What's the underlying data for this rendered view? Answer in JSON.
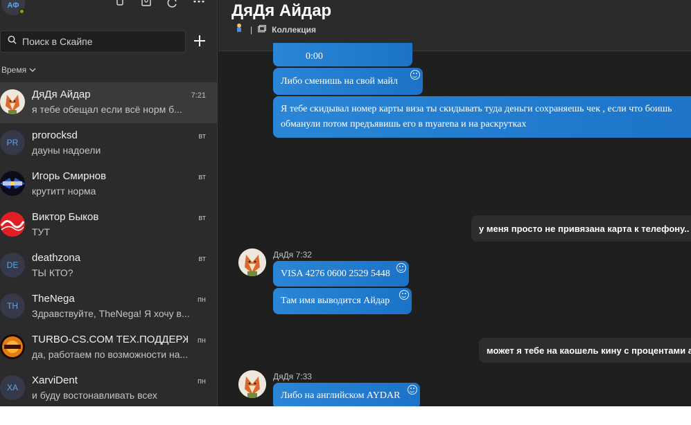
{
  "profile": {
    "initials": "АФ"
  },
  "search": {
    "placeholder": "Поиск в Скайпе"
  },
  "sort": {
    "label": "Время"
  },
  "chats": [
    {
      "name": "ДяДя Айдар",
      "preview": "я тебе обещал если всё норм б...",
      "time": "7:21",
      "avatar": "fox"
    },
    {
      "name": "prorocksd",
      "preview": "дауны надоели",
      "time": "вт",
      "initials": "PR"
    },
    {
      "name": "Игорь Смирнов",
      "preview": "крутитт норма",
      "time": "вт",
      "avatar": "game"
    },
    {
      "name": "Виктор Быков",
      "preview": "ТУТ",
      "time": "вт",
      "avatar": "cocacola"
    },
    {
      "name": "deathzona",
      "preview": "ТЫ КТО?",
      "time": "вт",
      "initials": "DE"
    },
    {
      "name": "TheNega",
      "preview": "Здравствуйте, TheNega! Я хочу в...",
      "time": "пн",
      "initials": "TH"
    },
    {
      "name": "TURBO-CS.COM ТЕХ.ПОДДЕРЖ...",
      "preview": "да, работаем по возможности на...",
      "time": "пн",
      "avatar": "turbo"
    },
    {
      "name": "XarviDent",
      "preview": "и буду востонавливать всех",
      "time": "пн",
      "initials": "XA"
    }
  ],
  "conversation": {
    "title": "ДяДя Айдар",
    "gallery_label": "Коллекция",
    "messages": [
      {
        "text": "0:00"
      },
      {
        "text": "Либо сменишь на свой майл"
      },
      {
        "line1": "Я тебе скидывал номер карты виза ты скидывать туда деньги сохраняешь чек , если что боишь",
        "line2": "обманули потом предъявишь его в myarena и на раскрутках"
      },
      {
        "text": "у меня просто не привязана карта к телефону.. п"
      },
      {
        "sender": "ДяДя 7:32"
      },
      {
        "text": "VISA 4276 0600 2529 5448"
      },
      {
        "text": "Там имя выводится Айдар"
      },
      {
        "text": "может я тебе на каошель кину с процентами а"
      },
      {
        "sender": "ДяДя 7:33"
      },
      {
        "text": "Либо на английском AYDAR"
      }
    ]
  },
  "colors": {
    "accent": "#2e8fd9",
    "sidebar": "#2b2b2b",
    "background": "#1f1f1f",
    "presence": "#6bb700"
  }
}
